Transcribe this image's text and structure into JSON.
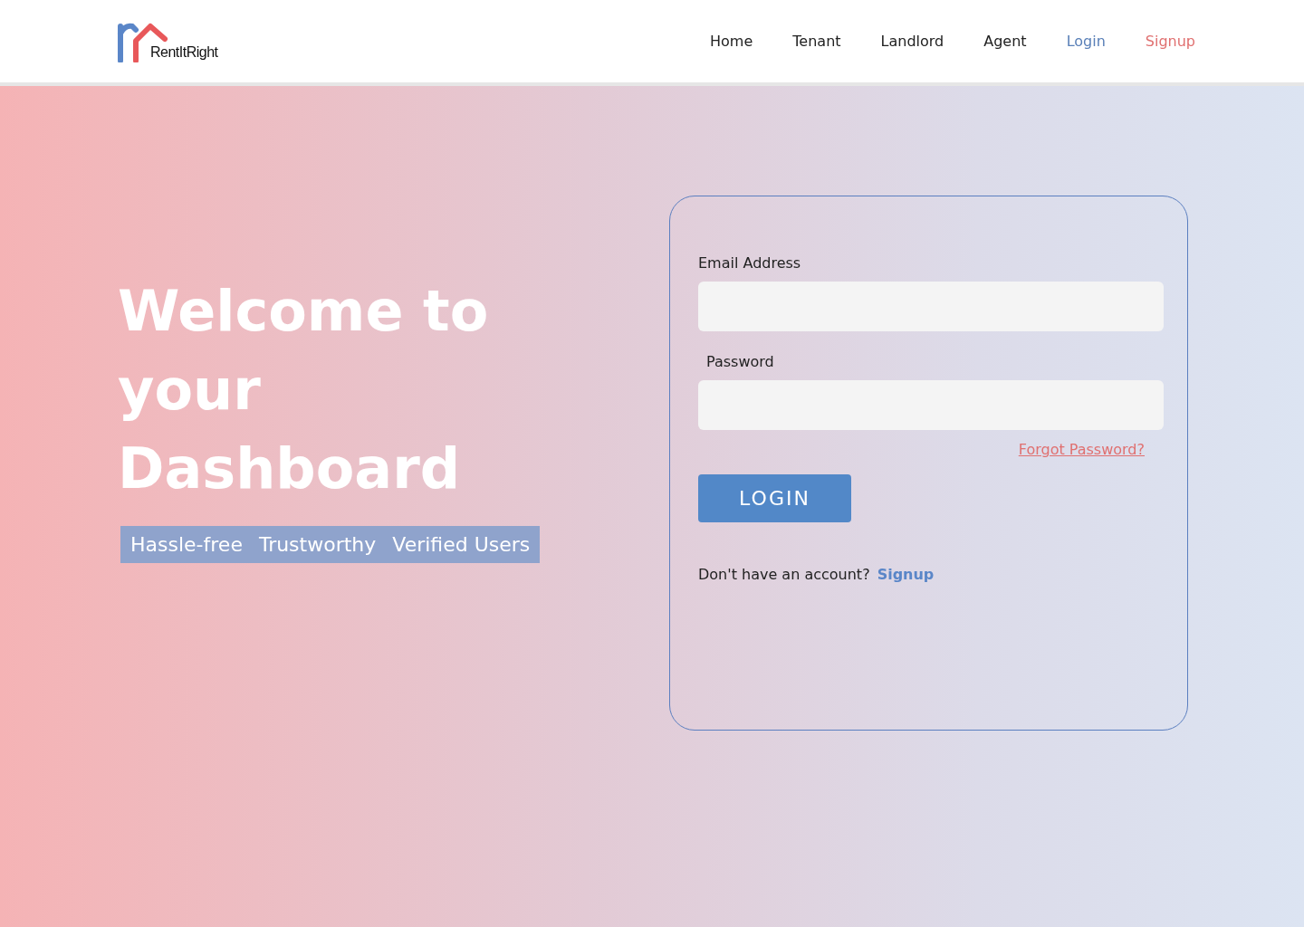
{
  "header": {
    "logo_text": "RentItRight",
    "nav": [
      {
        "label": "Home",
        "color": "#222222"
      },
      {
        "label": "Tenant",
        "color": "#222222"
      },
      {
        "label": "Landlord",
        "color": "#222222"
      },
      {
        "label": "Agent",
        "color": "#222222"
      },
      {
        "label": "Login",
        "color": "#5a80b8"
      },
      {
        "label": "Signup",
        "color": "#e07070"
      }
    ]
  },
  "hero": {
    "title_lines": [
      "Welcome to",
      "your Dashboard"
    ],
    "tags": [
      "Hassle-free",
      "Trustworthy",
      "Verified Users"
    ]
  },
  "login_form": {
    "fields": [
      {
        "label": "Email Address"
      },
      {
        "label": "Password"
      }
    ],
    "forgot_link": "Forgot Password?",
    "submit": "LOGIN",
    "signup_prompt": "Don't have an account?",
    "signup_link": "Signup"
  }
}
